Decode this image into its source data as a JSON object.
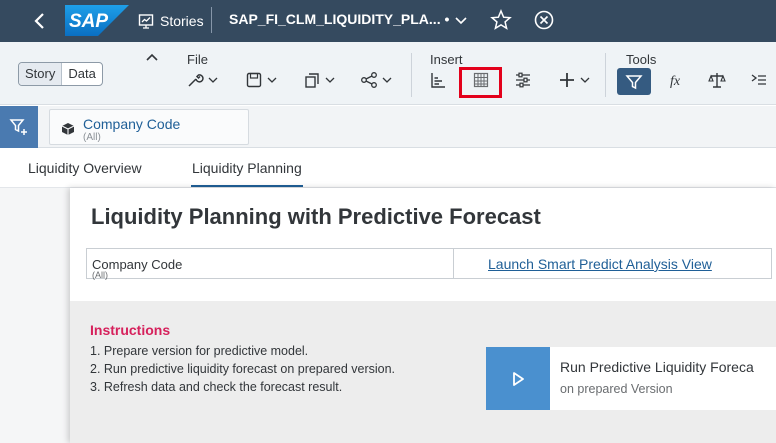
{
  "shell": {
    "logo_text": "SAP",
    "stories_label": "Stories",
    "document_title": "SAP_FI_CLM_LIQUIDITY_PLA... •"
  },
  "toolbar": {
    "view_toggle": [
      "Story",
      "Data"
    ],
    "groups": {
      "file": "File",
      "insert": "Insert",
      "tools": "Tools"
    },
    "highlight_color": "#e3001b"
  },
  "filterbar": {
    "company_code_label": "Company Code",
    "company_code_value": "(All)"
  },
  "tabs": [
    "Liquidity Overview",
    "Liquidity Planning"
  ],
  "active_tab": "Liquidity Planning",
  "page": {
    "title": "Liquidity Planning with Predictive Forecast",
    "company_code_label": "Company Code",
    "company_code_value": "(All)",
    "link_text": "Launch Smart Predict Analysis View",
    "instructions_title": "Instructions",
    "instructions": [
      "1. Prepare version for predictive model.",
      "2. Run predictive liquidity forecast on prepared version.",
      "3. Refresh data and check the forecast result."
    ],
    "run_title": "Run Predictive Liquidity Foreca",
    "run_subtitle": "on prepared Version"
  }
}
